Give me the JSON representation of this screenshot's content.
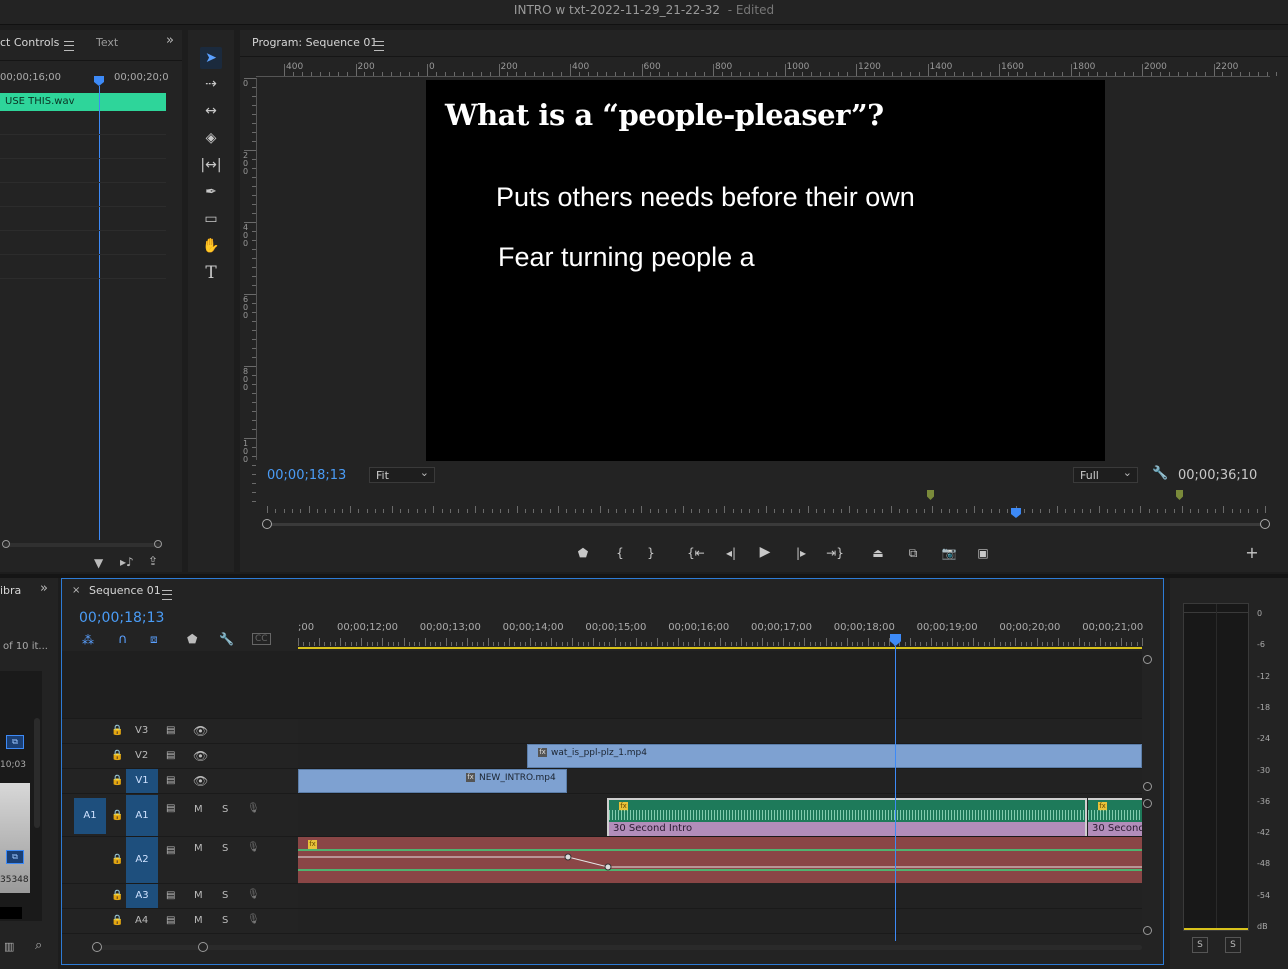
{
  "window": {
    "title": "INTRO w txt-2022-11-29_21-22-32",
    "edited": "- Edited"
  },
  "effect_controls": {
    "tab_label": "ct Controls",
    "tab2_label": "Text",
    "time_left": "00;00;16;00",
    "time_right": "00;00;20;0",
    "clip_label": "USE THIS.wav"
  },
  "program": {
    "tab_label": "Program: Sequence 01",
    "ruler_h": [
      "400",
      "200",
      "0",
      "200",
      "400",
      "600",
      "800",
      "1000",
      "1200",
      "1400",
      "1600",
      "1800",
      "2000",
      "2200"
    ],
    "ruler_v": [
      "0",
      "200",
      "400",
      "600",
      "800",
      "100"
    ],
    "heading": "What is a “people-pleaser”?",
    "line1": "Puts others needs before their own",
    "line2": "Fear turning people a",
    "timecode": "00;00;18;13",
    "fit": "Fit",
    "quality": "Full",
    "duration": "00;00;36;10",
    "playhead_fraction": 0.51
  },
  "project_panel": {
    "tab_label": "ibra",
    "count": "of 10 it...",
    "thumb1_time": "10;03",
    "thumb2_time": "35348"
  },
  "timeline": {
    "tab_label": "Sequence 01",
    "timecode": "00;00;18;13",
    "ruler": [
      ";00",
      "00;00;12;00",
      "00;00;13;00",
      "00;00;14;00",
      "00;00;15;00",
      "00;00;16;00",
      "00;00;17;00",
      "00;00;18;00",
      "00;00;19;00",
      "00;00;20;00",
      "00;00;21;00"
    ],
    "tracks": [
      {
        "id": "V3",
        "type": "video"
      },
      {
        "id": "V2",
        "type": "video"
      },
      {
        "id": "V1",
        "type": "video"
      },
      {
        "id": "A1",
        "type": "audio",
        "source": "A1",
        "m": "M",
        "s": "S"
      },
      {
        "id": "A2",
        "type": "audio",
        "m": "M",
        "s": "S"
      },
      {
        "id": "A3",
        "type": "audio",
        "m": "M",
        "s": "S"
      },
      {
        "id": "A4",
        "type": "audio",
        "m": "M",
        "s": "S"
      }
    ],
    "clips": {
      "v2": "wat_is_ppl-plz_1.mp4",
      "v1": "NEW_INTRO.mp4",
      "a1_a": "30 Second Intro",
      "a1_b": "30 Second"
    }
  },
  "audio_meter": {
    "scale": [
      "0",
      "-6",
      "-12",
      "-18",
      "-24",
      "-30",
      "-36",
      "-42",
      "-48",
      "-54",
      "dB"
    ],
    "solo_left": "S",
    "solo_right": "S"
  }
}
